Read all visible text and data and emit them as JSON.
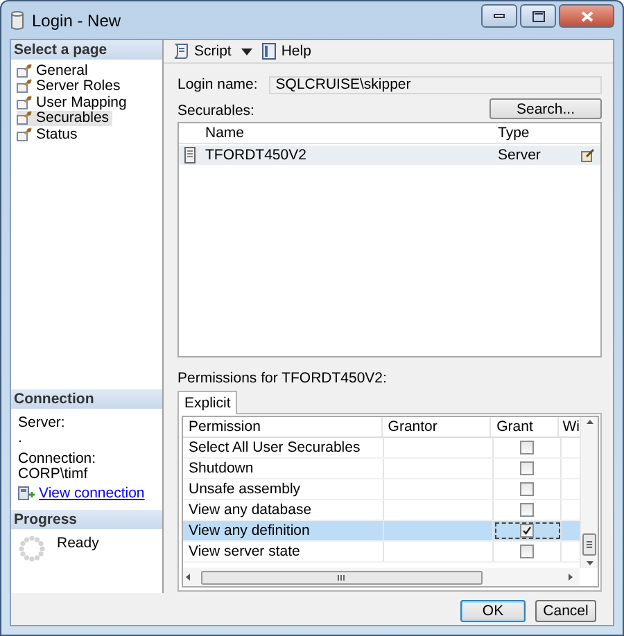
{
  "window": {
    "title": "Login - New"
  },
  "sidebar": {
    "header": "Select a page",
    "items": [
      {
        "label": "General",
        "selected": false
      },
      {
        "label": "Server Roles",
        "selected": false
      },
      {
        "label": "User Mapping",
        "selected": false
      },
      {
        "label": "Securables",
        "selected": true
      },
      {
        "label": "Status",
        "selected": false
      }
    ]
  },
  "connection": {
    "header": "Connection",
    "server_label": "Server:",
    "server_value": ".",
    "connection_label": "Connection:",
    "connection_value": "CORP\\timf",
    "link": "View connection"
  },
  "progress": {
    "header": "Progress",
    "status": "Ready"
  },
  "toolbar": {
    "script": "Script",
    "help": "Help"
  },
  "login_name": {
    "label": "Login name:",
    "value": "SQLCRUISE\\skipper"
  },
  "securables": {
    "label": "Securables:",
    "search_button": "Search...",
    "columns": [
      "Name",
      "Type"
    ],
    "rows": [
      {
        "name": "TFORDT450V2",
        "type": "Server",
        "selected": true
      }
    ]
  },
  "permissions": {
    "label": "Permissions for TFORDT450V2:",
    "tabs": [
      {
        "label": "Explicit",
        "selected": true
      }
    ],
    "columns": [
      "Permission",
      "Grantor",
      "Grant",
      "Wi"
    ],
    "rows": [
      {
        "permission": "Select All User Securables",
        "grant": false,
        "selected": false
      },
      {
        "permission": "Shutdown",
        "grant": false,
        "selected": false
      },
      {
        "permission": "Unsafe assembly",
        "grant": false,
        "selected": false
      },
      {
        "permission": "View any database",
        "grant": false,
        "selected": false
      },
      {
        "permission": "View any definition",
        "grant": true,
        "selected": true
      },
      {
        "permission": "View server state",
        "grant": false,
        "selected": false
      }
    ]
  },
  "buttons": [
    "OK",
    "Cancel"
  ]
}
